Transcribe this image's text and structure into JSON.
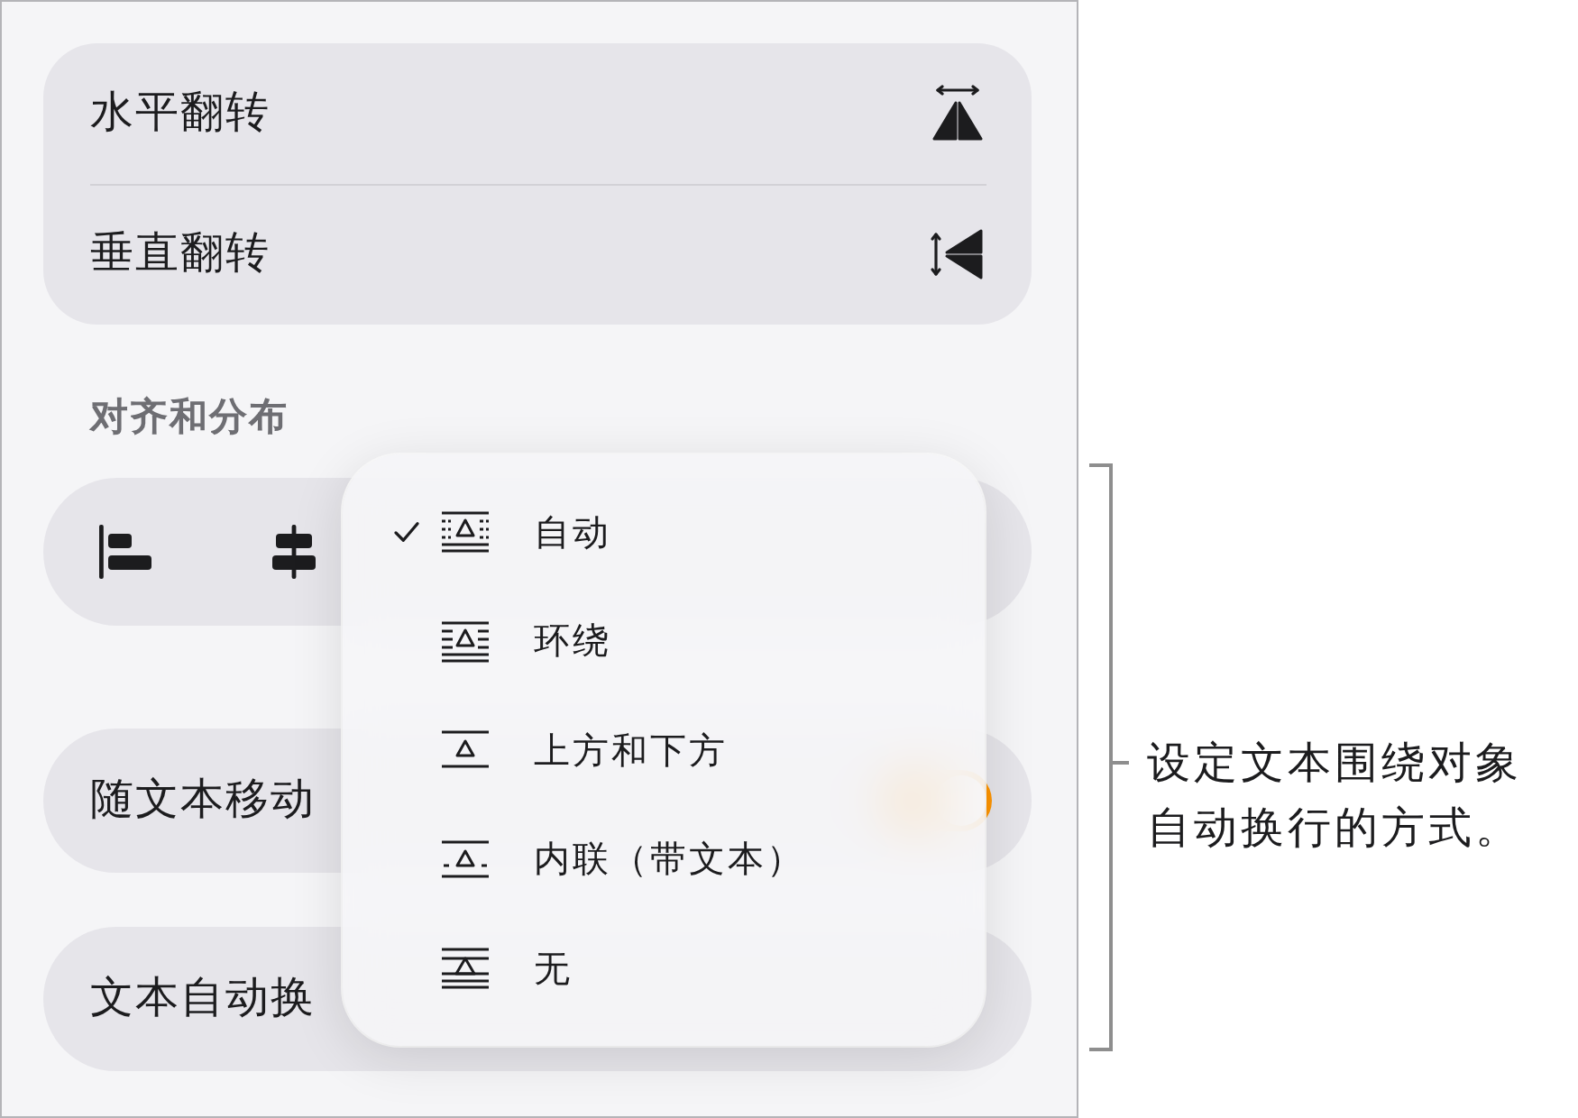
{
  "flip_options": [
    {
      "label": "水平翻转",
      "kind": "horizontal"
    },
    {
      "label": "垂直翻转",
      "kind": "vertical"
    }
  ],
  "align_section": {
    "title": "对齐和分布"
  },
  "move_with_text": {
    "label": "随文本移动",
    "on": true
  },
  "text_wrap": {
    "label": "文本自动换"
  },
  "wrap_menu": {
    "items": [
      {
        "label": "自动",
        "kind": "auto",
        "selected": true
      },
      {
        "label": "环绕",
        "kind": "around",
        "selected": false
      },
      {
        "label": "上方和下方",
        "kind": "above_below",
        "selected": false
      },
      {
        "label": "内联（带文本）",
        "kind": "inline",
        "selected": false
      },
      {
        "label": "无",
        "kind": "none",
        "selected": false
      }
    ]
  },
  "callout": {
    "text": "设定文本围绕对象自动换行的方式。"
  }
}
